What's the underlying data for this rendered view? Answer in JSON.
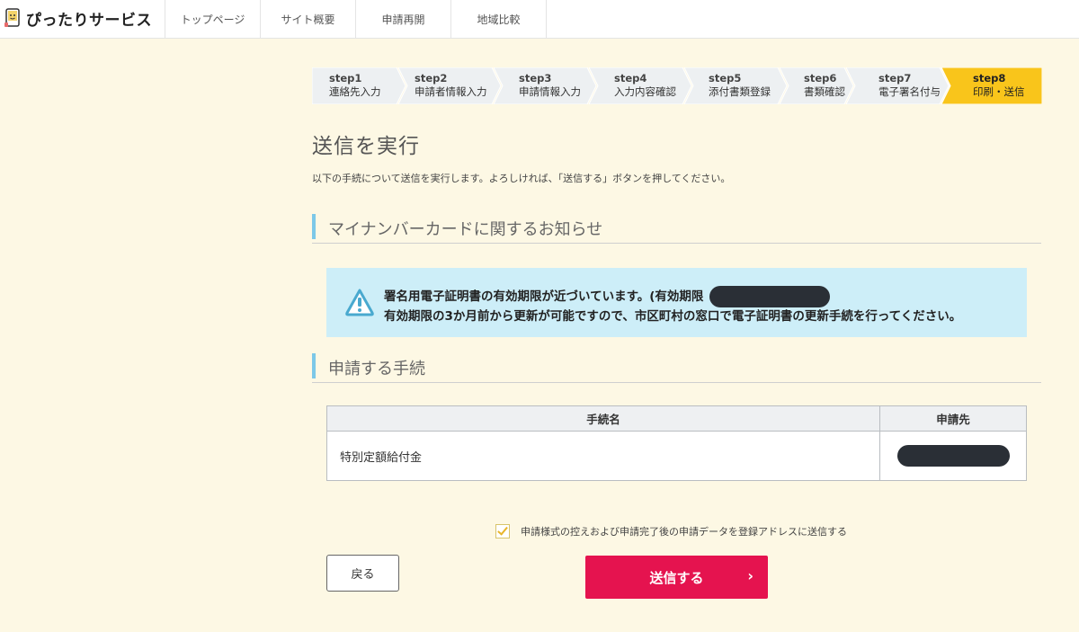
{
  "header": {
    "logo_text": "ぴったりサービス",
    "nav": [
      "トップページ",
      "サイト概要",
      "申請再開",
      "地域比較"
    ]
  },
  "steps": [
    {
      "num": "step1",
      "label": "連絡先入力"
    },
    {
      "num": "step2",
      "label": "申請者情報入力"
    },
    {
      "num": "step3",
      "label": "申請情報入力"
    },
    {
      "num": "step4",
      "label": "入力内容確認"
    },
    {
      "num": "step5",
      "label": "添付書類登録"
    },
    {
      "num": "step6",
      "label": "書類確認"
    },
    {
      "num": "step7",
      "label": "電子署名付与"
    },
    {
      "num": "step8",
      "label": "印刷・送信"
    }
  ],
  "current_step": "step8",
  "main": {
    "title": "送信を実行",
    "lead": "以下の手続について送信を実行します。よろしければ、「送信する」ボタンを押してください。"
  },
  "notice_section": {
    "heading": "マイナンバーカードに関するお知らせ",
    "line1": "署名用電子証明書の有効期限が近づいています。(有効期限",
    "line2": "有効期限の3か月前から更新が可能ですので、市区町村の窓口で電子証明書の更新手続を行ってください。"
  },
  "procedure_section": {
    "heading": "申請する手続",
    "columns": [
      "手続名",
      "申請先"
    ],
    "rows": [
      {
        "name": "特別定額給付金",
        "destination": ""
      }
    ]
  },
  "agreement": {
    "checked": true,
    "label": "申請様式の控えおよび申請完了後の申請データを登録アドレスに送信する"
  },
  "buttons": {
    "back": "戻る",
    "submit": "送信する",
    "submit_chevron": "›"
  },
  "colors": {
    "background": "#fdf8e4",
    "step_inactive": "#edf0f2",
    "step_active": "#f9c51b",
    "section_accent": "#7cc8e8",
    "notice_bg": "#cdeef8",
    "submit": "#e5134f",
    "redaction": "#2a2f36"
  },
  "icons": {
    "logo": "tablet-character-logo",
    "notice": "warning-triangle-icon",
    "chevron": "chevron-right-icon",
    "checkbox": "check-icon"
  }
}
